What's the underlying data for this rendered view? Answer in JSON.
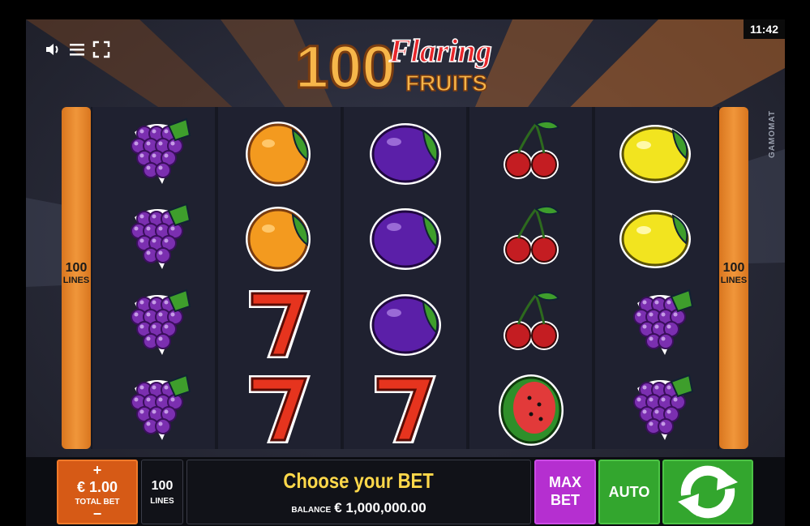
{
  "status": {
    "time": "11:42"
  },
  "header": {
    "logo_number": "100",
    "logo_word1": "Flaring",
    "logo_word2": "FRUITS",
    "icons": [
      "sound-icon",
      "menu-icon",
      "fullscreen-icon"
    ]
  },
  "brand": "GAMOMAT",
  "side_labels": {
    "count": "100",
    "word": "LINES"
  },
  "reels": [
    [
      "grapes",
      "grapes",
      "grapes",
      "grapes"
    ],
    [
      "orange",
      "orange",
      "seven",
      "seven"
    ],
    [
      "plum",
      "plum",
      "plum",
      "seven"
    ],
    [
      "cherries",
      "cherries",
      "cherries",
      "watermelon"
    ],
    [
      "lemon",
      "lemon",
      "grapes",
      "grapes"
    ]
  ],
  "controls": {
    "bet_plus": "+",
    "bet_value": "€ 1.00",
    "bet_label": "TOTAL BET",
    "bet_minus": "−",
    "lines_value": "100",
    "lines_label": "LINES",
    "message": "Choose your BET",
    "balance_label": "BALANCE",
    "balance_value": "€ 1,000,000.00",
    "maxbet_line1": "MAX",
    "maxbet_line2": "BET",
    "auto_label": "AUTO"
  },
  "colors": {
    "bet": "#d65a16",
    "maxbet": "#b52fd0",
    "auto": "#33a62e",
    "message": "#ffd84a",
    "side": "#f0963a"
  }
}
